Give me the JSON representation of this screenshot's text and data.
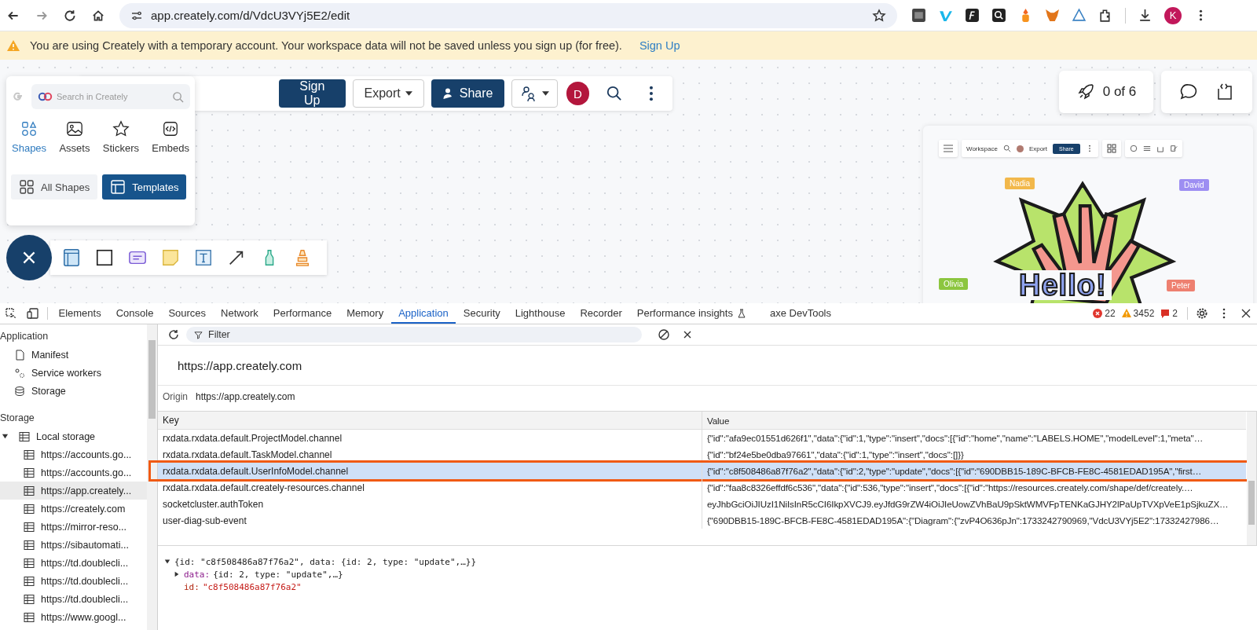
{
  "browser": {
    "url": "app.creately.com/d/VdcU3VYj5E2/edit",
    "profile_initial": "K"
  },
  "banner": {
    "message": "You are using Creately with a temporary account. Your workspace data will not be saved unless you sign up (for free).",
    "link": "Sign Up"
  },
  "app_toolbar": {
    "sign_up": "Sign Up",
    "export": "Export",
    "share": "Share",
    "avatar_initial": "D"
  },
  "shapes_panel": {
    "search_placeholder": "Search in Creately",
    "tabs": [
      {
        "label": "Shapes",
        "selected": true
      },
      {
        "label": "Assets",
        "selected": false
      },
      {
        "label": "Stickers",
        "selected": false
      },
      {
        "label": "Embeds",
        "selected": false
      }
    ],
    "buttons": [
      {
        "label": "All Shapes",
        "selected": false
      },
      {
        "label": "Templates",
        "selected": true
      }
    ]
  },
  "presentation": {
    "counter": "0 of 6"
  },
  "preview": {
    "workspace": "Workspace",
    "export": "Export",
    "share": "Share",
    "greeting": "Hello!",
    "cursors": [
      {
        "name": "Nadia",
        "color": "#f2b84b"
      },
      {
        "name": "David",
        "color": "#9d8ef2"
      },
      {
        "name": "Olivia",
        "color": "#8cc63f"
      },
      {
        "name": "Peter",
        "color": "#ee8070"
      }
    ]
  },
  "devtools": {
    "tabs": [
      {
        "label": "Elements",
        "selected": false
      },
      {
        "label": "Console",
        "selected": false
      },
      {
        "label": "Sources",
        "selected": false
      },
      {
        "label": "Network",
        "selected": false
      },
      {
        "label": "Performance",
        "selected": false
      },
      {
        "label": "Memory",
        "selected": false
      },
      {
        "label": "Application",
        "selected": true
      },
      {
        "label": "Security",
        "selected": false
      },
      {
        "label": "Lighthouse",
        "selected": false
      },
      {
        "label": "Recorder",
        "selected": false
      },
      {
        "label": "Performance insights",
        "selected": false
      },
      {
        "label": "axe DevTools",
        "selected": false
      }
    ],
    "errors": "22",
    "warnings": "3452",
    "issues": "2",
    "sidebar": {
      "application_title": "Application",
      "application_items": [
        "Manifest",
        "Service workers",
        "Storage"
      ],
      "storage_title": "Storage",
      "local_storage": {
        "label": "Local storage",
        "expanded": true,
        "children": [
          {
            "label": "https://accounts.go...",
            "selected": false
          },
          {
            "label": "https://accounts.go...",
            "selected": false
          },
          {
            "label": "https://app.creately...",
            "selected": true
          },
          {
            "label": "https://creately.com",
            "selected": false
          },
          {
            "label": "https://mirror-reso...",
            "selected": false
          },
          {
            "label": "https://sibautomati...",
            "selected": false
          },
          {
            "label": "https://td.doublecli...",
            "selected": false
          },
          {
            "label": "https://td.doublecli...",
            "selected": false
          },
          {
            "label": "https://td.doublecli...",
            "selected": false
          },
          {
            "label": "https://www.googl...",
            "selected": false
          }
        ]
      }
    },
    "filter_placeholder": "Filter",
    "origin_heading": "https://app.creately.com",
    "origin_label": "Origin",
    "origin_value": "https://app.creately.com",
    "table": {
      "columns": [
        "Key",
        "Value"
      ],
      "rows": [
        {
          "key": "rxdata.rxdata.default.ProjectModel.channel",
          "value": "{\"id\":\"afa9ec01551d626f1\",\"data\":{\"id\":1,\"type\":\"insert\",\"docs\":[{\"id\":\"home\",\"name\":\"LABELS.HOME\",\"modelLevel\":1,\"meta\"…",
          "selected": false
        },
        {
          "key": "rxdata.rxdata.default.TaskModel.channel",
          "value": "{\"id\":\"bf24e5be0dba97661\",\"data\":{\"id\":1,\"type\":\"insert\",\"docs\":[]}}",
          "selected": false
        },
        {
          "key": "rxdata.rxdata.default.UserInfoModel.channel",
          "value": "{\"id\":\"c8f508486a87f76a2\",\"data\":{\"id\":2,\"type\":\"update\",\"docs\":[{\"id\":\"690DBB15-189C-BFCB-FE8C-4581EDAD195A\",\"first…",
          "selected": true
        },
        {
          "key": "rxdata.rxdata.default.creately-resources.channel",
          "value": "{\"id\":\"faa8c8326effdf6c536\",\"data\":{\"id\":536,\"type\":\"insert\",\"docs\":[{\"id\":\"https://resources.creately.com/shape/def/creately.…",
          "selected": false
        },
        {
          "key": "socketcluster.authToken",
          "value": "eyJhbGciOiJIUzI1NiIsInR5cCI6IkpXVCJ9.eyJfdG9rZW4iOiJIeUowZVhBaU9pSktWMVFpTENKaGJHY2lPaUpTVXpVeE1pSjkuZX…",
          "selected": false
        },
        {
          "key": "user-diag-sub-event",
          "value": "{\"690DBB15-189C-BFCB-FE8C-4581EDAD195A\":{\"Diagram\":{\"zvP4O636pJn\":1733242790969,\"VdcU3VYj5E2\":17332427986…",
          "selected": false
        }
      ]
    },
    "object_preview": {
      "summary": "{id: \"c8f508486a87f76a2\", data: {id: 2, type: \"update\",…}}",
      "expanded": true,
      "properties": [
        {
          "key": "data:",
          "value": "{id: 2, type: \"update\",…}",
          "kind": "object"
        },
        {
          "key": "id:",
          "value": "\"c8f508486a87f76a2\"",
          "kind": "string"
        }
      ]
    }
  }
}
